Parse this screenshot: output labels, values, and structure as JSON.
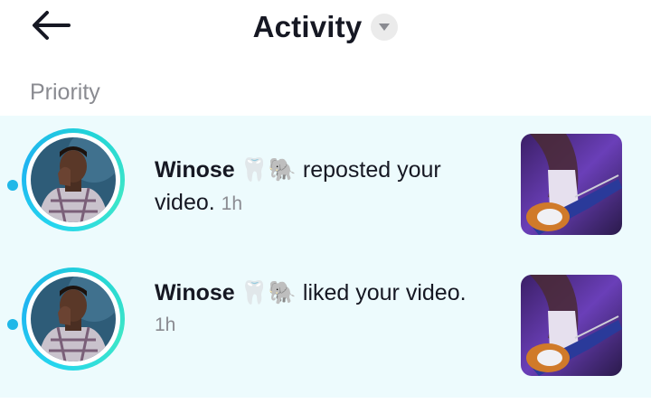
{
  "header": {
    "title": "Activity",
    "back_icon": "arrow-left-icon",
    "caret_icon": "caret-down-icon"
  },
  "section": {
    "label": "Priority"
  },
  "notifications": [
    {
      "username": "Winose",
      "emoji": "🦷🐘",
      "action": "reposted your video.",
      "time": "1h",
      "unread": true
    },
    {
      "username": "Winose",
      "emoji": "🦷🐘",
      "action": "liked your video.",
      "time": "1h",
      "unread": true
    }
  ],
  "colors": {
    "accent": "#20b8e8",
    "row_background": "#edfbfd",
    "secondary_text": "#8a8b91"
  }
}
